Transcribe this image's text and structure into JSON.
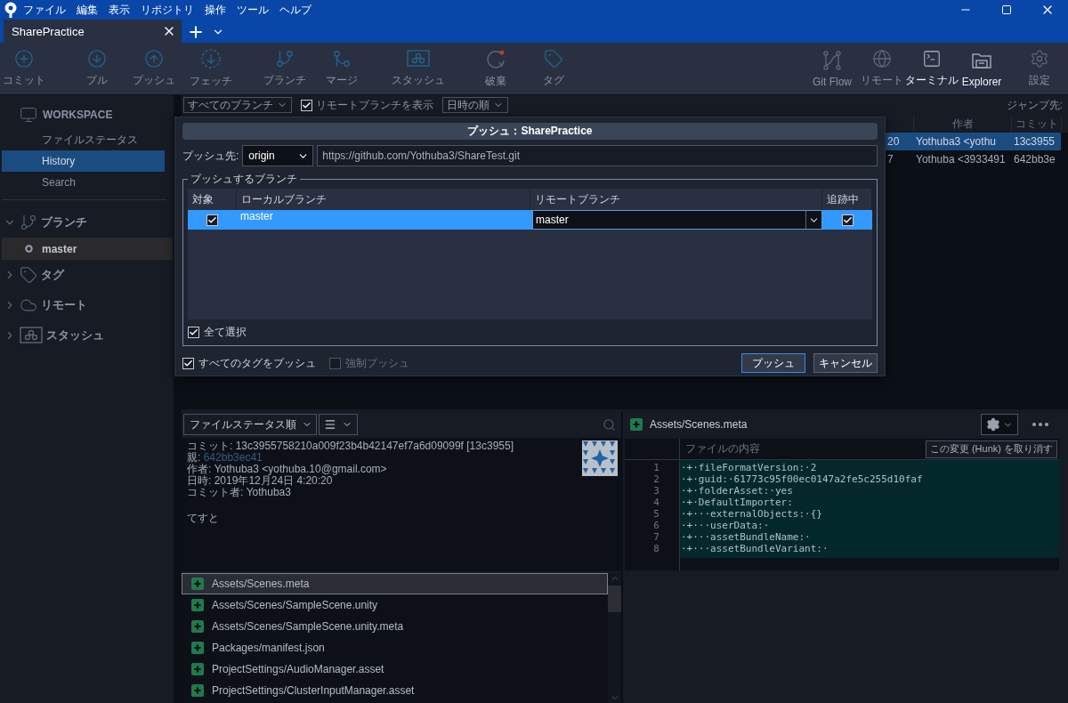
{
  "menu_bar": {
    "items": [
      "ファイル",
      "編集",
      "表示",
      "リポジトリ",
      "操作",
      "ツール",
      "ヘルプ"
    ]
  },
  "tabs": [
    {
      "label": "SharePractice",
      "selected": true
    }
  ],
  "toolbar": {
    "left_buttons": [
      {
        "label": "コミット",
        "disabled": true
      },
      {
        "label": "プル",
        "disabled": true
      },
      {
        "label": "プッシュ",
        "disabled": true
      },
      {
        "label": "フェッチ",
        "disabled": true
      },
      {
        "label": "ブランチ",
        "disabled": true
      },
      {
        "label": "マージ",
        "disabled": true
      },
      {
        "label": "スタッシュ",
        "disabled": true
      },
      {
        "label": "破棄",
        "disabled": true
      },
      {
        "label": "タグ",
        "disabled": true
      }
    ],
    "right_buttons": [
      {
        "label": "Git Flow",
        "disabled": true
      },
      {
        "label": "リモート",
        "disabled": true
      },
      {
        "label": "ターミナル",
        "disabled": false
      },
      {
        "label": "Explorer",
        "disabled": false
      },
      {
        "label": "設定",
        "disabled": true
      }
    ]
  },
  "sidebar": {
    "workspace": {
      "title": "WORKSPACE",
      "items": [
        {
          "label": "ファイルステータス",
          "selected": false
        },
        {
          "label": "History",
          "selected": true
        },
        {
          "label": "Search",
          "selected": false
        }
      ]
    },
    "sections": [
      {
        "label": "ブランチ",
        "expanded": true,
        "items": [
          {
            "label": "master",
            "selected": true
          }
        ]
      },
      {
        "label": "タグ",
        "expanded": false
      },
      {
        "label": "リモート",
        "expanded": false
      },
      {
        "label": "スタッシュ",
        "expanded": false
      }
    ]
  },
  "history": {
    "filters": {
      "branch": "すべてのブランチ",
      "show_remote": {
        "label": "リモートブランチを表示",
        "checked": true
      },
      "order": "日時の順",
      "jump_label": "ジャンプ先:"
    },
    "columns": [
      "作者",
      "コミット"
    ],
    "rows": [
      {
        "column_1": "20",
        "author": "Yothuba3 <yothu",
        "commit": "13c3955",
        "selected": true
      },
      {
        "column_1": "7",
        "author": "Yothuba <3933491",
        "commit": "642bb3e",
        "selected": false
      }
    ]
  },
  "push_dialog": {
    "title": "プッシュ：SharePractice",
    "remote_label": "プッシュ先:",
    "remote": "origin",
    "url": "https://github.com/Yothuba3/ShareTest.git",
    "branches_legend": "プッシュするブランチ",
    "columns": [
      "対象",
      "ローカルブランチ",
      "リモートブランチ",
      "追跡中"
    ],
    "branches": [
      {
        "checked": true,
        "local": "master",
        "remote": "master",
        "tracking": true,
        "selected": true
      }
    ],
    "select_all": {
      "label": "全て選択",
      "checked": true
    },
    "options": [
      {
        "label": "すべてのタグをプッシュ",
        "checked": true,
        "disabled": false
      },
      {
        "label": "強制プッシュ",
        "checked": false,
        "disabled": true
      }
    ],
    "buttons": [
      {
        "label": "プッシュ",
        "primary": true
      },
      {
        "label": "キャンセル",
        "primary": false
      }
    ]
  },
  "commit_panel": {
    "sort": "ファイルステータス順",
    "details": [
      {
        "label": "コミット:",
        "value": "13c3955758210a009f23b4b42147ef7a6d09099f [13c3955]",
        "kind": "text"
      },
      {
        "label": "親:",
        "value": "642bb3ec41",
        "kind": "link"
      },
      {
        "label": "作者:",
        "value": "Yothuba3 <yothuba.10@gmail.com>",
        "kind": "text"
      },
      {
        "label": "日時:",
        "value": "2019年12月24日 4:20:20",
        "kind": "text"
      },
      {
        "label": "コミット者:",
        "value": "Yothuba3",
        "kind": "text"
      }
    ],
    "message": "てすと",
    "files": [
      {
        "path": "Assets/Scenes.meta",
        "selected": true
      },
      {
        "path": "Assets/Scenes/SampleScene.unity",
        "selected": false
      },
      {
        "path": "Assets/Scenes/SampleScene.unity.meta",
        "selected": false
      },
      {
        "path": "Packages/manifest.json",
        "selected": false
      },
      {
        "path": "ProjectSettings/AudioManager.asset",
        "selected": false
      },
      {
        "path": "ProjectSettings/ClusterInputManager.asset",
        "selected": false
      }
    ]
  },
  "diff_panel": {
    "file": "Assets/Scenes.meta",
    "header": "ファイルの内容",
    "hunk_button": "この変更 (Hunk) を取り消す",
    "lines": [
      {
        "number": "1",
        "text": "·+·fileFormatVersion:·2"
      },
      {
        "number": "2",
        "text": "·+·guid:·61773c95f00ec0147a2fe5c255d10faf"
      },
      {
        "number": "3",
        "text": "·+·folderAsset:·yes"
      },
      {
        "number": "4",
        "text": "·+·DefaultImporter:"
      },
      {
        "number": "5",
        "text": "·+···externalObjects:·{}"
      },
      {
        "number": "6",
        "text": "·+···userData:·"
      },
      {
        "number": "7",
        "text": "·+···assetBundleName:·"
      },
      {
        "number": "8",
        "text": "·+···assetBundleVariant:·"
      }
    ]
  }
}
